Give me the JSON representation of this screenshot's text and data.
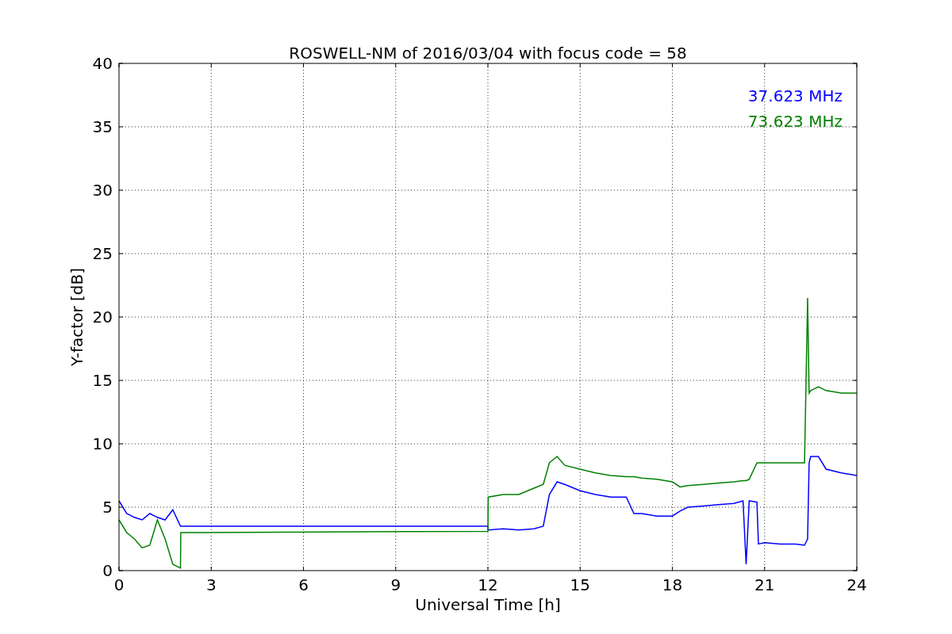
{
  "figure": {
    "chart_data": {
      "type": "line",
      "title": "ROSWELL-NM of 2016/03/04 with focus code = 58",
      "xlabel": "Universal Time [h]",
      "ylabel": "Y-factor [dB]",
      "x": [
        0,
        0.25,
        0.5,
        0.75,
        1,
        1.25,
        1.5,
        1.75,
        2,
        2.01,
        12,
        12.01,
        12.5,
        13,
        13.5,
        13.8,
        14,
        14.25,
        14.5,
        15,
        15.5,
        16,
        16.5,
        16.75,
        17,
        17.5,
        18,
        18.25,
        18.5,
        19,
        19.5,
        20,
        20.3,
        20.4,
        20.5,
        20.75,
        20.8,
        21,
        21.5,
        22,
        22.3,
        22.4,
        22.45,
        22.5,
        22.75,
        23,
        23.5,
        24
      ],
      "series": [
        {
          "name": "37.623 MHz",
          "color": "#0000ff",
          "values": [
            5.5,
            4.5,
            4.2,
            4,
            4.5,
            4.2,
            4,
            4.8,
            3.5,
            3.5,
            3.5,
            3.2,
            3.3,
            3.2,
            3.3,
            3.5,
            6,
            7,
            6.8,
            6.3,
            6,
            5.8,
            5.8,
            4.5,
            4.5,
            4.3,
            4.3,
            4.7,
            5,
            5.1,
            5.2,
            5.3,
            5.5,
            0.5,
            5.5,
            5.4,
            2.1,
            2.2,
            2.1,
            2.1,
            2,
            2.5,
            8.5,
            9,
            9,
            8,
            7.7,
            7.5
          ]
        },
        {
          "name": "73.623 MHz",
          "color": "#008000",
          "values": [
            4,
            3,
            2.5,
            1.8,
            2,
            4,
            2.5,
            0.5,
            0.2,
            3,
            3.1,
            5.8,
            6,
            6,
            6.5,
            6.8,
            8.5,
            9,
            8.3,
            8,
            7.7,
            7.5,
            7.4,
            7.4,
            7.3,
            7.2,
            7,
            6.6,
            6.7,
            6.8,
            6.9,
            7,
            7.1,
            7.1,
            7.2,
            8.5,
            8.5,
            8.5,
            8.5,
            8.5,
            8.5,
            21.5,
            14,
            14.2,
            14.5,
            14.2,
            14,
            14
          ]
        }
      ],
      "xlim": [
        0,
        24
      ],
      "ylim": [
        0,
        40
      ],
      "xticks": [
        0,
        3,
        6,
        9,
        12,
        15,
        18,
        21,
        24
      ],
      "yticks": [
        0,
        5,
        10,
        15,
        20,
        25,
        30,
        35,
        40
      ],
      "grid": true
    }
  }
}
